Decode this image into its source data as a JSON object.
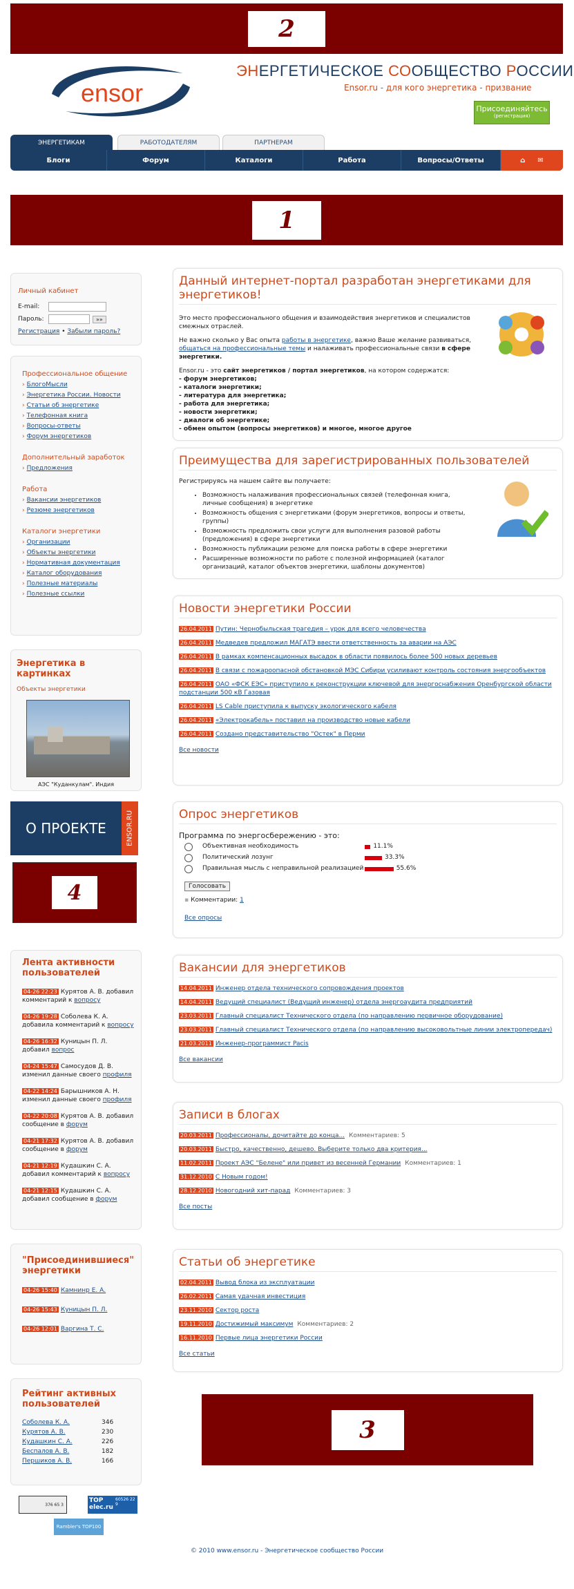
{
  "banners": {
    "top": "2",
    "middle": "1",
    "bottom": "3",
    "left": "4"
  },
  "header": {
    "logo": "ensor",
    "title_parts": [
      {
        "text": "ЭН",
        "color": "#cf4a1b"
      },
      {
        "text": "ЕРГЕТИЧЕСКОЕ ",
        "color": "#1d3e64"
      },
      {
        "text": "СО",
        "color": "#cf4a1b"
      },
      {
        "text": "ОБЩЕСТВО ",
        "color": "#1d3e64"
      },
      {
        "text": "Р",
        "color": "#cf4a1b"
      },
      {
        "text": "ОССИИ",
        "color": "#1d3e64"
      }
    ],
    "tagline_site": "Ensor.ru",
    "tagline_rest": " - для кого энергетика - призвание",
    "join_label": "Присоединяйтесь",
    "join_sub": "(регистрация)"
  },
  "tabs": [
    "ЭНЕРГЕТИКАМ",
    "РАБОТОДАТЕЛЯМ",
    "ПАРТНЕРАМ"
  ],
  "menu": [
    "Блоги",
    "Форум",
    "Каталоги",
    "Работа",
    "Вопросы/Ответы"
  ],
  "login": {
    "title": "Личный кабинет",
    "email_label": "E-mail:",
    "password_label": "Пароль:",
    "go": "»»",
    "register": "Регистрация",
    "sep": " • ",
    "forgot": "Забыли пароль?"
  },
  "leftnav": {
    "groups": [
      {
        "title": "Профессиональное общение",
        "items": [
          "БлогоМысли",
          "Энергетика России. Новости",
          "Статьи об энергетике",
          "Телефонная книга",
          "Вопросы-ответы",
          "Форум энергетиков"
        ]
      },
      {
        "title": "Дополнительный заработок",
        "items": [
          "Предложения"
        ]
      },
      {
        "title": "Работа",
        "items": [
          "Вакансии энергетиков",
          "Резюме энергетиков"
        ]
      },
      {
        "title": "Каталоги энергетики",
        "items": [
          "Организации",
          "Объекты энергетики",
          "Нормативная документация",
          "Каталог оборудования",
          "Полезные материалы",
          "Полезные ссылки"
        ]
      }
    ]
  },
  "pictures": {
    "title": "Энергетика в картинках",
    "sub": "Объекты энергетики",
    "caption": "АЭС \"Куданкулам\". Индия"
  },
  "about": {
    "text": "О ПРОЕКТЕ",
    "side": "ENSOR.RU"
  },
  "activity": {
    "title": "Лента активности пользователей",
    "items": [
      {
        "date": "04-26 22:23",
        "text": "Курятов А. В. добавил комментарий к ",
        "link": "вопросу"
      },
      {
        "date": "04-26 19:28",
        "text": "Соболева К. А. добавила комментарий к ",
        "link": "вопросу"
      },
      {
        "date": "04-26 16:32",
        "text": "Куницын П. Л. добавил ",
        "link": "вопрос"
      },
      {
        "date": "04-24 15:47",
        "text": "Самосудов Д. В. изменил данные своего ",
        "link": "профиля"
      },
      {
        "date": "04-22 14:24",
        "text": "Барышников А. Н. изменил данные своего ",
        "link": "профиля"
      },
      {
        "date": "04-22 20:08",
        "text": "Курятов А. В. добавил сообщение в ",
        "link": "форум"
      },
      {
        "date": "04-21 17:32",
        "text": "Курятов А. В. добавил сообщение в ",
        "link": "форум"
      },
      {
        "date": "04-21 12:19",
        "text": "Кудашкин С. А. добавил комментарий к ",
        "link": "вопросу"
      },
      {
        "date": "04-21 12:15",
        "text": "Кудашкин С. А. добавил сообщение в ",
        "link": "форум"
      }
    ]
  },
  "joined": {
    "title": "\"Присоединившиеся\" энергетики",
    "items": [
      {
        "date": "04-26 15:40",
        "name": "Камнинр Е. А."
      },
      {
        "date": "04-26 15:43",
        "name": "Куницын П. Л."
      },
      {
        "date": "04-26 12:01",
        "name": "Варгина Т. С."
      }
    ]
  },
  "rating": {
    "title": "Рейтинг активных пользователей",
    "items": [
      {
        "name": "Соболева К. А.",
        "score": "346"
      },
      {
        "name": "Курятов А. В.",
        "score": "230"
      },
      {
        "name": "Кудашкин С. А.",
        "score": "226"
      },
      {
        "name": "Беспалов А. В.",
        "score": "182"
      },
      {
        "name": "Першиков А. В.",
        "score": "166"
      }
    ]
  },
  "counters": {
    "c1": "376 65 3",
    "top": "TOP elec.ru",
    "top_nums": "60526 22 9",
    "rambler": "Rambler's TOP100"
  },
  "intro": {
    "title": "Данный интернет-портал разработан энергетиками для энергетиков!",
    "p1": "Это место профессионального общения и взаимодействия энергетиков и специалистов смежных отраслей.",
    "p2a": "Не важно сколько у Вас опыта ",
    "p2link1": "работы в энергетике",
    "p2b": ", важно Ваше желание развиваться, ",
    "p2link2": "общаться на профессиональные темы",
    "p2c": " и налаживать профессиональные связи ",
    "p2bold": "в сфере энергетики.",
    "p3a": "Ensor.ru - это ",
    "p3bold": "сайт энергетиков / портал энергетиков",
    "p3b": ", на котором содержатся:",
    "list": [
      "- форум энергетиков;",
      "- каталоги энергетики;",
      "- литература для энергетика;",
      "- работа для энергетика;",
      "- новости энергетики;",
      "- диалоги об энергетике;",
      "- обмен опытом (вопросы энергетиков) и многое, многое другое"
    ]
  },
  "benefits": {
    "title": "Преимущества для зарегистрированных пользователей",
    "lead": "Регистрируясь на нашем сайте вы получаете:",
    "items": [
      "Возможность налаживания профессиональных связей (телефонная книга, личные сообщения) в энергетике",
      "Возможность общения с энергетиками (форум энергетиков, вопросы и ответы, группы)",
      "Возможность предложить свои услуги для выполнения разовой работы (предложения) в сфере энергетики",
      "Возможность публикации резюме для поиска работы в сфере энергетики",
      "Расширенные возможности по работе с полезной информацией (каталог организаций, каталог объектов энергетики, шаблоны документов)"
    ]
  },
  "news": {
    "title": "Новости энергетики России",
    "items": [
      {
        "date": "26.04.2011",
        "text": "Путин: Чернобыльская трагедия – урок для всего человечества"
      },
      {
        "date": "26.04.2011",
        "text": "Медведев предложил МАГАТЭ ввести ответственность за аварии на АЭС"
      },
      {
        "date": "26.04.2011",
        "text": "В рамках компенсационных высадок в области появилось более 500 новых деревьев"
      },
      {
        "date": "26.04.2011",
        "text": "В связи с пожароопасной обстановкой МЭС Сибири усиливают контроль состояния энергообъектов"
      },
      {
        "date": "26.04.2011",
        "text": "ОАО «ФСК ЕЭС» приступило к реконструкции ключевой для энергоснабжения Оренбургской области подстанции 500 кВ Газовая"
      },
      {
        "date": "26.04.2011",
        "text": "LS Cable приступила к выпуску экологического кабеля"
      },
      {
        "date": "26.04.2011",
        "text": "«Электрокабель» поставил на производство новые кабели"
      },
      {
        "date": "26.04.2011",
        "text": "Создано представительство \"Остек\" в Перми"
      }
    ],
    "all": "Все новости"
  },
  "poll": {
    "title": "Опрос энергетиков",
    "question": "Программа по энергосбережению - это:",
    "options": [
      {
        "label": "Объективная необходимость",
        "pct": "11.1%",
        "value": 11.1
      },
      {
        "label": "Политический лозунг",
        "pct": "33.3%",
        "value": 33.3
      },
      {
        "label": "Правильная мысль с неправильной реализацией",
        "pct": "55.6%",
        "value": 55.6
      }
    ],
    "vote": "Голосовать",
    "comments_label": "Комментарии: ",
    "comments_count": "1",
    "all": "Все опросы"
  },
  "vacancies": {
    "title": "Вакансии для энергетиков",
    "items": [
      {
        "date": "14.04.2011",
        "text": "Инженер отдела технического сопровождения проектов"
      },
      {
        "date": "14.04.2011",
        "text": "Ведущий специалист (Ведущий инженер) отдела энергоаудита предприятий"
      },
      {
        "date": "23.03.2011",
        "text": "Главный специалист Технического отдела (по направлению первичное оборудование)"
      },
      {
        "date": "23.03.2011",
        "text": "Главный специалист Технического отдела (по направлению высоковольтные линии электропередач)"
      },
      {
        "date": "21.03.2011",
        "text": "Инженер-программист Pacis"
      }
    ],
    "all": "Все вакансии"
  },
  "blogs": {
    "title": "Записи в блогах",
    "items": [
      {
        "date": "20.03.2011",
        "text": "Профессионалы, дочитайте до конца...",
        "extra": "Комментариев: 5"
      },
      {
        "date": "20.03.2011",
        "text": "Быстро, качественно, дешево. Выберите только два критерия...",
        "extra": ""
      },
      {
        "date": "11.02.2011",
        "text": "Проект АЭС \"Белене\" или привет из весенней Германии",
        "extra": "Комментариев: 1"
      },
      {
        "date": "31.12.2010",
        "text": "С Новым годом!",
        "extra": ""
      },
      {
        "date": "28.12.2010",
        "text": "Новогодний хит-парад",
        "extra": "Комментариев: 3"
      }
    ],
    "all": "Все посты"
  },
  "articles": {
    "title": "Статьи об энергетике",
    "items": [
      {
        "date": "02.04.2011",
        "text": "Вывод блока из эксплуатации",
        "extra": ""
      },
      {
        "date": "26.02.2011",
        "text": "Самая удачная инвестиция",
        "extra": ""
      },
      {
        "date": "23.11.2010",
        "text": "Сектор роста",
        "extra": ""
      },
      {
        "date": "19.11.2010",
        "text": "Достижимый максимум",
        "extra": "Комментариев: 2"
      },
      {
        "date": "16.11.2010",
        "text": "Первые лица энергетики России",
        "extra": ""
      }
    ],
    "all": "Все статьи"
  },
  "footer": {
    "text": "© 2010 www.ensor.ru - Энергетическое сообщество России"
  }
}
